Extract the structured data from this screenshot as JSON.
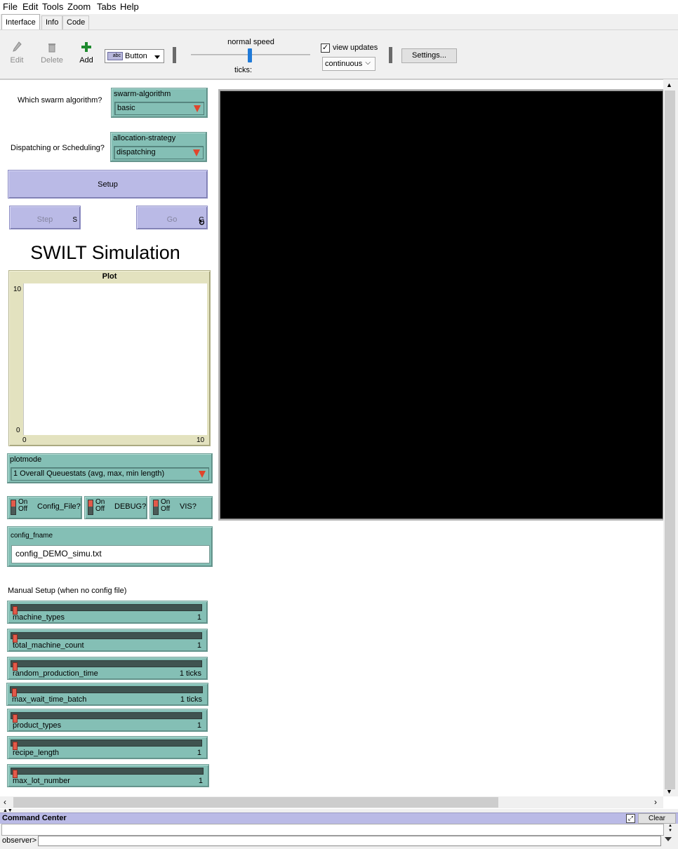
{
  "menu": [
    "File",
    "Edit",
    "Tools",
    "Zoom",
    "Tabs",
    "Help"
  ],
  "tabs": [
    "Interface",
    "Info",
    "Code"
  ],
  "toolbar": {
    "edit_label": "Edit",
    "delete_label": "Delete",
    "add_label": "Add",
    "widget_type": "Button",
    "widget_type_icon_text": "abc",
    "speed_label": "normal speed",
    "ticks_label": "ticks:",
    "view_updates_label": "view updates",
    "view_updates_checked": true,
    "update_mode": "continuous",
    "settings_label": "Settings...",
    "speed_fraction": 0.5
  },
  "interface": {
    "choosers": [
      {
        "note": "Which swarm algorithm?",
        "name": "swarm-algorithm",
        "value": "basic"
      },
      {
        "note": "Dispatching or Scheduling?",
        "name": "allocation-strategy",
        "value": "dispatching"
      }
    ],
    "setup_label": "Setup",
    "step": {
      "label": "Step",
      "key": "S"
    },
    "go": {
      "label": "Go",
      "key": "G",
      "forever_icon": "↻"
    },
    "title": "SWILT Simulation",
    "plot": {
      "title": "Plot",
      "y_max": "10",
      "y_min": "0",
      "x_min": "0",
      "x_max": "10"
    },
    "plotmode": {
      "name": "plotmode",
      "value": "1 Overall Queuestats (avg, max, min length)"
    },
    "switch_on": "On",
    "switch_off": "Off",
    "switches": [
      {
        "label": "Config_File?"
      },
      {
        "label": "DEBUG?"
      },
      {
        "label": "VIS?"
      }
    ],
    "config_input": {
      "label": "config_fname",
      "value": "config_DEMO_simu.txt"
    },
    "manual_note": "Manual Setup (when no config file)",
    "sliders": [
      {
        "name": "machine_types",
        "value": "1"
      },
      {
        "name": "total_machine_count",
        "value": "1"
      },
      {
        "name": "random_production_time",
        "value": "1 ticks"
      },
      {
        "name": "max_wait_time_batch",
        "value": "1 ticks"
      },
      {
        "name": "product_types",
        "value": "1"
      },
      {
        "name": "recipe_length",
        "value": "1"
      },
      {
        "name": "max_lot_number",
        "value": "1"
      }
    ]
  },
  "command_center": {
    "title": "Command Center",
    "clear_label": "Clear",
    "agent": "observer>"
  },
  "colors": {
    "widget_green": "#84bfb5",
    "button_purple": "#babae6",
    "plot_bg": "#e3e2bf",
    "view_bg": "#000000",
    "switch_red": "#e25a4a"
  }
}
